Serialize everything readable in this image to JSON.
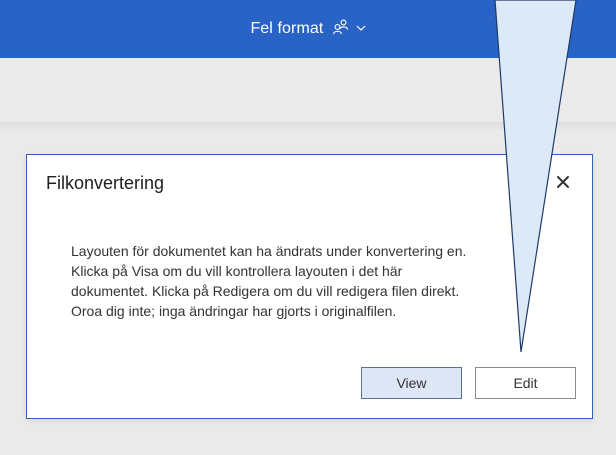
{
  "header": {
    "doc_title": "Fel format",
    "icons": [
      "people-icon",
      "chevron-down-icon"
    ],
    "bar_color": "#2a63c6"
  },
  "dialog": {
    "title": "Filkonvertering",
    "body_lines": [
      "Layouten för dokumentet kan ha ändrats under konvertering en.",
      "Klicka på Visa om du vill kontrollera layouten i det här",
      "dokumentet. Klicka på Redigera om du vill redigera filen direkt.",
      "Oroa dig inte; inga ändringar har gjorts i originalfilen."
    ],
    "close_icon": "close-icon",
    "view_label": "View",
    "edit_label": "Edit",
    "border_color": "#2f62b8"
  },
  "annotation": {
    "shape": "callout-pointer-triangle",
    "fill_color": "#dce9f7",
    "stroke_color": "#1f3a66"
  }
}
